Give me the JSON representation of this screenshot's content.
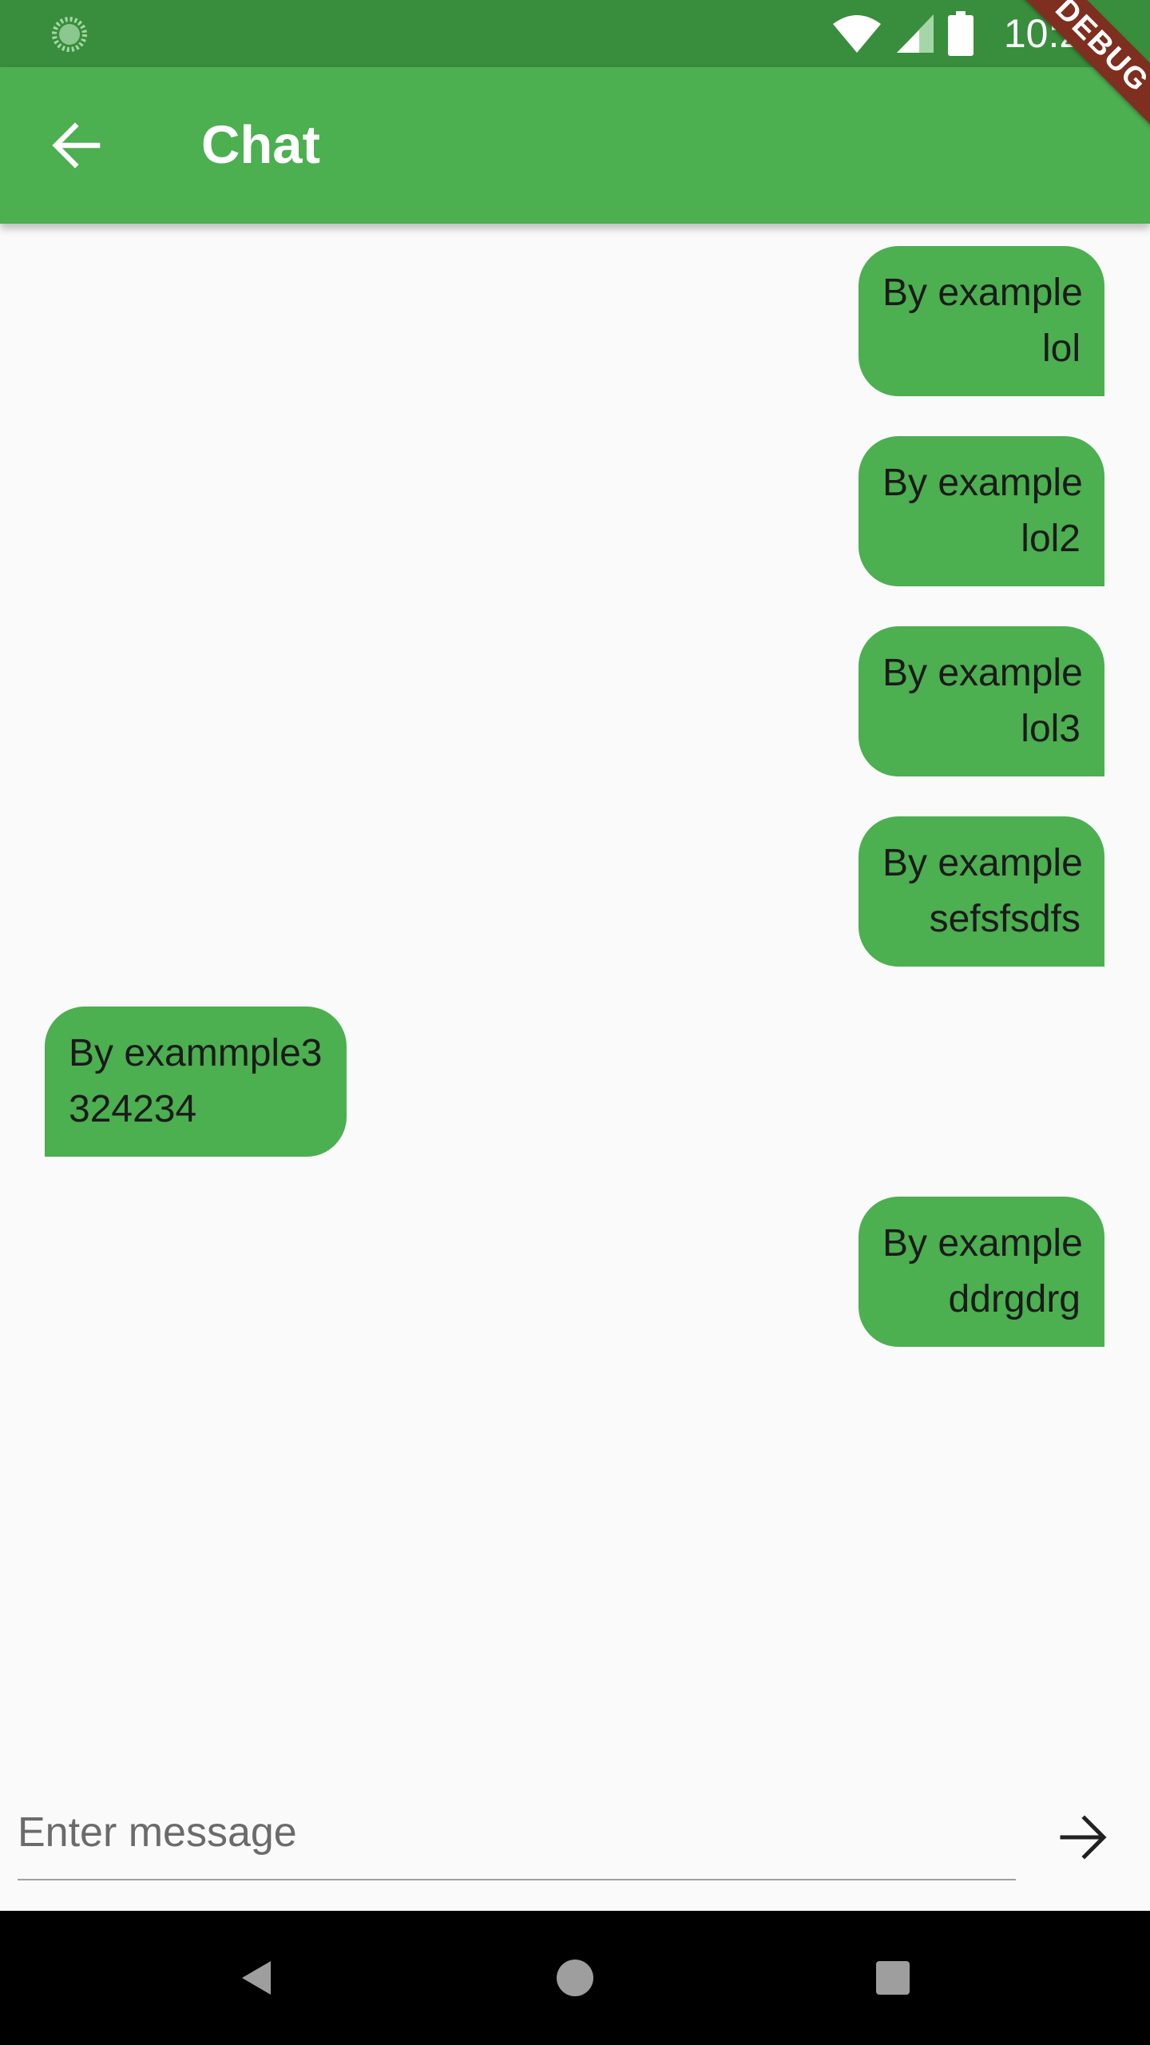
{
  "status_bar": {
    "time": "10:21",
    "icons": [
      "loading-spinner-icon",
      "wifi-icon",
      "cell-signal-icon",
      "battery-icon"
    ]
  },
  "app_bar": {
    "title": "Chat",
    "back_icon": "arrow-back-icon",
    "debug_banner": "DEBUG"
  },
  "messages": [
    {
      "direction": "sent",
      "lines": [
        "By example",
        "lol"
      ]
    },
    {
      "direction": "sent",
      "lines": [
        "By example",
        "lol2"
      ]
    },
    {
      "direction": "sent",
      "lines": [
        "By example",
        "lol3"
      ]
    },
    {
      "direction": "sent",
      "lines": [
        "By example",
        "sefsfsdfs"
      ]
    },
    {
      "direction": "received",
      "lines": [
        "By exammple3",
        "324234"
      ]
    },
    {
      "direction": "sent",
      "lines": [
        "By example",
        "ddrgdrg"
      ]
    }
  ],
  "input": {
    "placeholder": "Enter message",
    "value": "",
    "send_icon": "arrow-forward-icon"
  },
  "nav_bar": {
    "buttons": [
      "back-triangle-icon",
      "home-circle-icon",
      "recents-square-icon"
    ]
  },
  "colors": {
    "status_bar": "#388e3c",
    "app_bar": "#4caf50",
    "bubble": "#4caf50",
    "background": "#fafafa",
    "debug_banner": "#7f2f1f"
  }
}
